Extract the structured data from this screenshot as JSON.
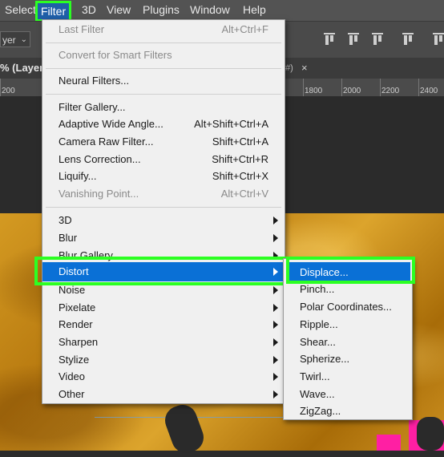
{
  "menubar": {
    "items": [
      "Select",
      "Filter",
      "3D",
      "View",
      "Plugins",
      "Window",
      "Help"
    ]
  },
  "options": {
    "layer_dropdown": "yer"
  },
  "tab": {
    "title_fragment": "% (Layer",
    "title_suffix": "#)",
    "close": "×"
  },
  "ruler": {
    "ticks": [
      "200",
      "1800",
      "2000",
      "2200",
      "2400"
    ]
  },
  "filter_menu": {
    "last_filter": {
      "label": "Last Filter",
      "shortcut": "Alt+Ctrl+F"
    },
    "convert": "Convert for Smart Filters",
    "neural": "Neural Filters...",
    "gallery": "Filter Gallery...",
    "adaptive": {
      "label": "Adaptive Wide Angle...",
      "shortcut": "Alt+Shift+Ctrl+A"
    },
    "camera_raw": {
      "label": "Camera Raw Filter...",
      "shortcut": "Shift+Ctrl+A"
    },
    "lens": {
      "label": "Lens Correction...",
      "shortcut": "Shift+Ctrl+R"
    },
    "liquify": {
      "label": "Liquify...",
      "shortcut": "Shift+Ctrl+X"
    },
    "vanishing": {
      "label": "Vanishing Point...",
      "shortcut": "Alt+Ctrl+V"
    },
    "submenus": [
      "3D",
      "Blur",
      "Blur Gallery",
      "Distort",
      "Noise",
      "Pixelate",
      "Render",
      "Sharpen",
      "Stylize",
      "Video",
      "Other"
    ]
  },
  "distort_menu": {
    "items": [
      "Displace...",
      "Pinch...",
      "Polar Coordinates...",
      "Ripple...",
      "Shear...",
      "Spherize...",
      "Twirl...",
      "Wave...",
      "ZigZag..."
    ]
  },
  "colors": {
    "highlight": "#0a70d6",
    "annotation_frame": "#2cff22",
    "menu_bg": "#f0f0f0"
  }
}
